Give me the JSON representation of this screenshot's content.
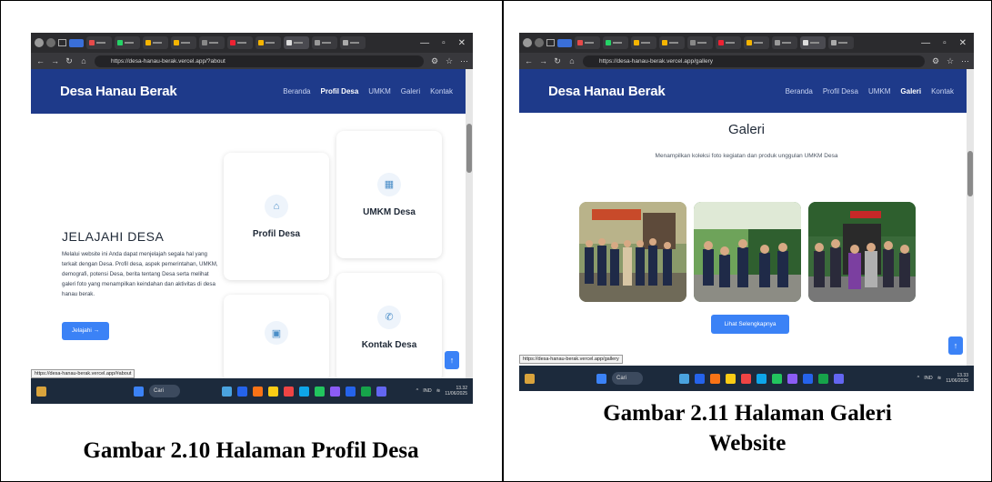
{
  "colors": {
    "nav_bg": "#1e3a8a",
    "accent": "#3b82f6",
    "browser_tabbar": "#2b2b2e",
    "taskbar": "#1c2a3c"
  },
  "figure1": {
    "url": "https://desa-hanau-berak.vercel.app/?about",
    "site": {
      "brand": "Desa Hanau Berak",
      "menu": [
        "Beranda",
        "Profil Desa",
        "UMKM",
        "Galeri",
        "Kontak"
      ],
      "active_menu": "Profil Desa"
    },
    "hero": {
      "title": "JELAJAHI DESA",
      "text": "Melalui website ini Anda dapat menjelajah segala hal yang terkait dengan Desa. Profil desa, aspek pemerintahan, UMKM, demografi, potensi Desa, berita tentang Desa serta melihat galeri foto yang menampilkan keindahan dan aktivitas di desa hanau berak.",
      "button": "Jelajahi →"
    },
    "cards": [
      {
        "title": "Profil Desa",
        "icon": "home-icon"
      },
      {
        "title": "UMKM Desa",
        "icon": "store-icon"
      },
      {
        "title": "",
        "icon": "image-icon"
      },
      {
        "title": "Kontak Desa",
        "icon": "phone-icon"
      }
    ],
    "status_url": "https://desa-hanau-berak.vercel.app/#about",
    "taskbar": {
      "search": "Cari",
      "lang": "IND",
      "time": "13.32",
      "date": "11/06/2025"
    },
    "up_button": "↑",
    "caption": "Gambar 2.10 Halaman Profil Desa"
  },
  "figure2": {
    "url": "https://desa-hanau-berak.vercel.app/gallery",
    "site": {
      "brand": "Desa Hanau Berak",
      "menu": [
        "Beranda",
        "Profil Desa",
        "UMKM",
        "Galeri",
        "Kontak"
      ],
      "active_menu": "Galeri"
    },
    "gallery": {
      "title": "Galeri",
      "subtitle": "Menampilkan koleksi foto kegiatan dan produk unggulan UMKM Desa",
      "button": "Lihat Selengkapnya"
    },
    "status_url": "https://desa-hanau-berak.vercel.app/gallery",
    "taskbar": {
      "search": "Cari",
      "lang": "IND",
      "time": "13.33",
      "date": "11/06/2025"
    },
    "up_button": "↑",
    "caption_line1": "Gambar 2.11 Halaman Galeri",
    "caption_line2": "Website"
  }
}
